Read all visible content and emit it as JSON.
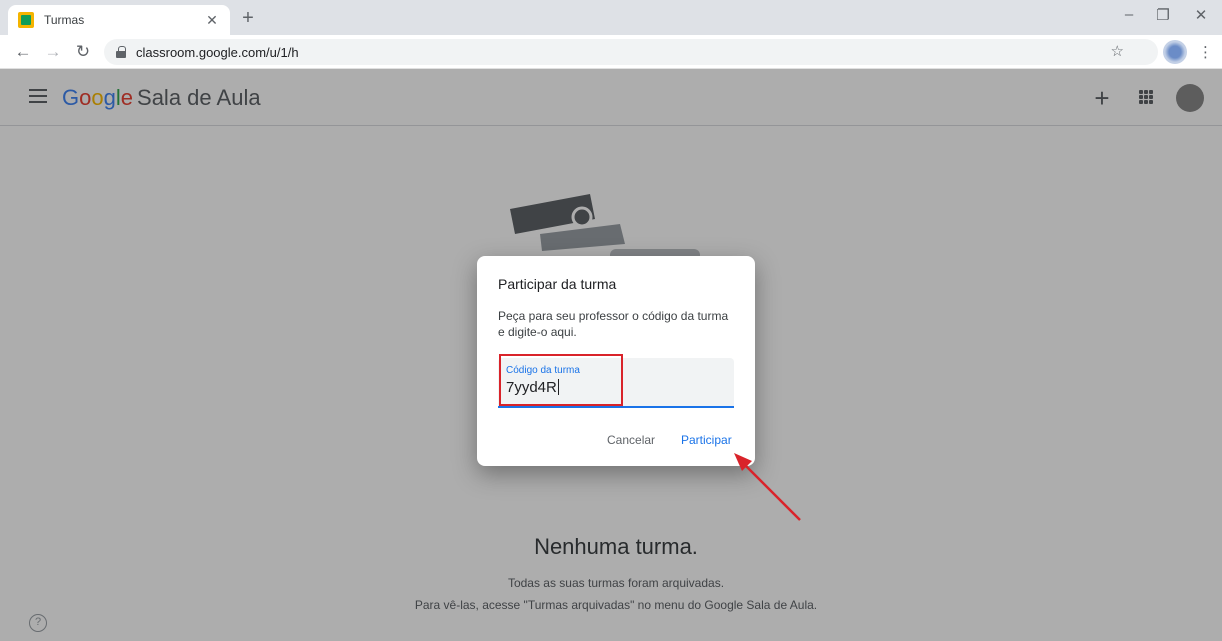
{
  "browser": {
    "tab_title": "Turmas",
    "url": "classroom.google.com/u/1/h"
  },
  "app": {
    "brand_letters": [
      "G",
      "o",
      "o",
      "g",
      "l",
      "e"
    ],
    "brand_name": "Sala de Aula"
  },
  "empty_state": {
    "title": "Nenhuma turma.",
    "line1": "Todas as suas turmas foram arquivadas.",
    "line2": "Para vê-las, acesse \"Turmas arquivadas\" no menu do Google Sala de Aula."
  },
  "dialog": {
    "title": "Participar da turma",
    "description": "Peça para seu professor o código da turma e digite-o aqui.",
    "field_label": "Código da turma",
    "field_value": "7yyd4R",
    "cancel_label": "Cancelar",
    "join_label": "Participar"
  },
  "colors": {
    "accent": "#1a73e8",
    "annotation": "#d9232a"
  }
}
